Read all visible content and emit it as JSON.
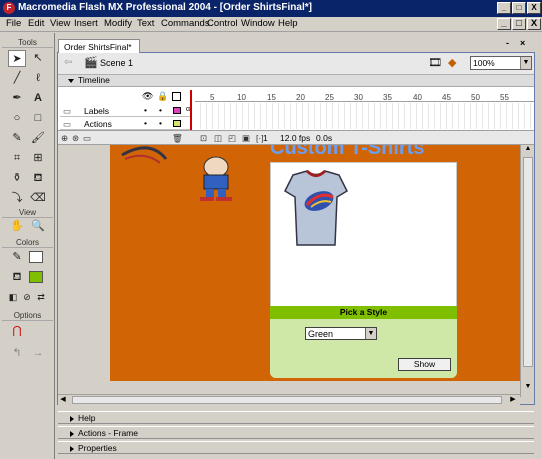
{
  "window": {
    "title": "Macromedia Flash MX Professional 2004 - [Order ShirtsFinal*]",
    "app_icon": "F",
    "controls": [
      "_",
      "□",
      "X"
    ]
  },
  "menu": {
    "items": [
      "File",
      "Edit",
      "View",
      "Insert",
      "Modify",
      "Text",
      "Commands",
      "Control",
      "Window",
      "Help"
    ]
  },
  "tools": {
    "heading": "Tools",
    "view_heading": "View",
    "colors_heading": "Colors",
    "options_heading": "Options"
  },
  "document": {
    "tab_label": "Order ShirtsFinal*",
    "scene_label": "Scene 1",
    "zoom_value": "100%",
    "window_controls": [
      "-",
      "×"
    ]
  },
  "timeline": {
    "heading": "Timeline",
    "layers": [
      "Labels",
      "Actions"
    ],
    "ruler_ticks": [
      "1",
      "5",
      "10",
      "15",
      "20",
      "25",
      "30",
      "35",
      "40",
      "45",
      "50",
      "55"
    ],
    "current_frame": "1",
    "fps": "12.0 fps",
    "elapsed": "0.0s"
  },
  "stage": {
    "header_text": "Custom T-Shirts",
    "style_bar_label": "Pick a Style",
    "combo_value": "Green",
    "show_button_label": "Show"
  },
  "panels": {
    "help": "Help",
    "actions": "Actions - Frame",
    "properties": "Properties"
  },
  "colors": {
    "stage_bg": "#d16405",
    "title_bar": "#0a246a",
    "style_bar": "#7fbf00",
    "card_bottom": "#cfe8a8"
  }
}
